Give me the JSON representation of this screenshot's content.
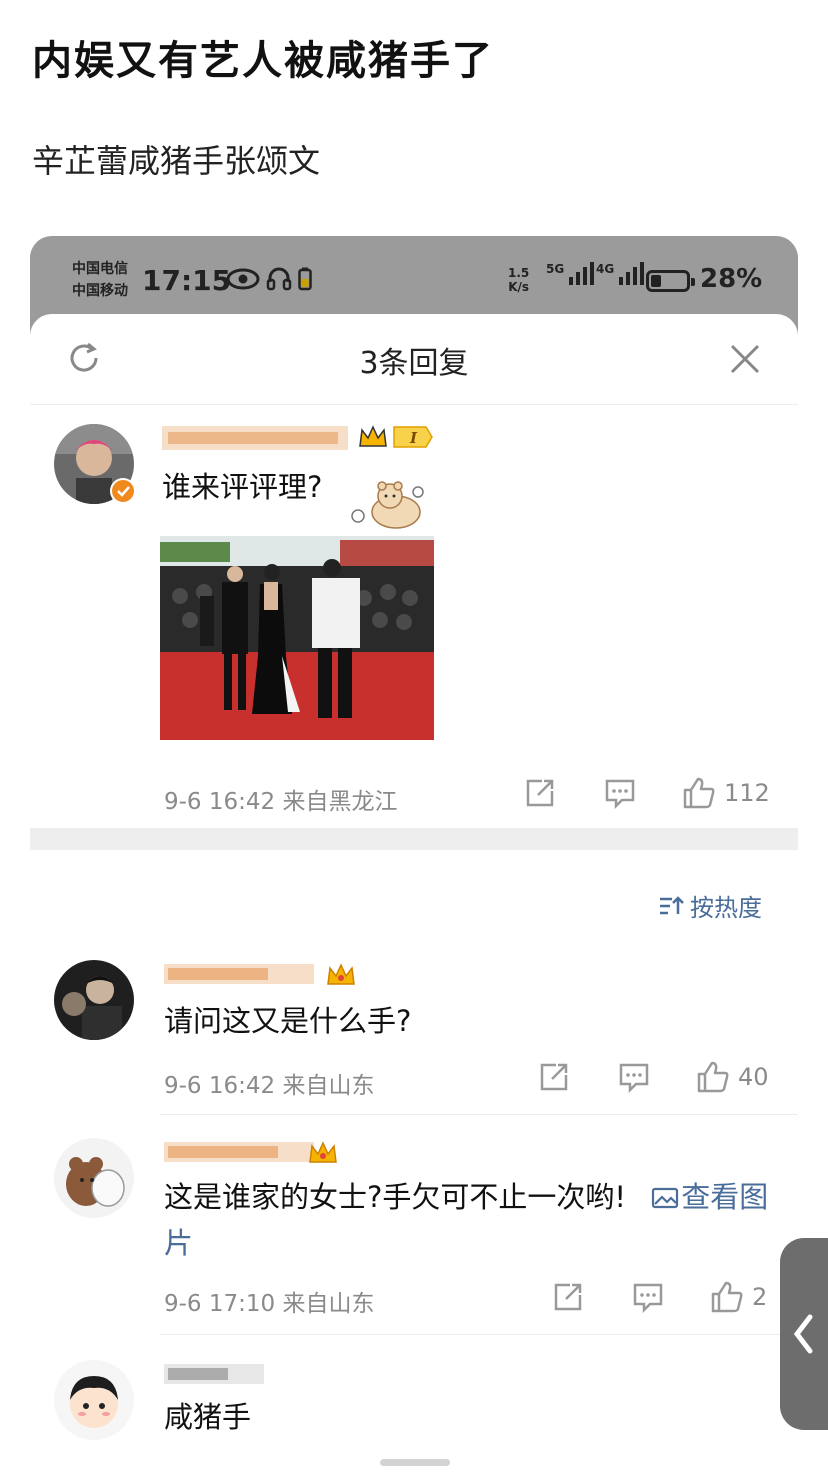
{
  "post": {
    "title": "内娱又有艺人被咸猪手了",
    "subtitle": "辛芷蕾咸猪手张颂文"
  },
  "statusbar": {
    "carrier1": "中国电信",
    "carrier2": "中国移动",
    "time": "17:15",
    "net_speed_top": "1.5",
    "net_speed_bottom": "K/s",
    "sig1_label": "5G",
    "sig2_label": "4G",
    "battery_level": 0.28,
    "battery_pct": "28%"
  },
  "sheet": {
    "title": "3条回复"
  },
  "main_comment": {
    "text": "谁来评评理?",
    "time_location": "9-6 16:42 来自黑龙江",
    "likes": "112"
  },
  "sort_label": "按热度",
  "replies": [
    {
      "text": "请问这又是什么手?",
      "time_location": "9-6 16:42 来自山东",
      "likes": "40"
    },
    {
      "text": "这是谁家的女士?手欠可不止一次哟!",
      "view_image": "查看图片",
      "time_location": "9-6 17:10 来自山东",
      "likes": "2"
    },
    {
      "text": "咸猪手"
    }
  ],
  "colors": {
    "statusbar_bg": "#9b9b9b",
    "username": "#e3862e",
    "link": "#4a6d9a",
    "meta": "#8a8a8a",
    "carpet_red": "#c8302e"
  },
  "icons": [
    "refresh-icon",
    "close-icon",
    "share-icon",
    "comment-icon",
    "thumbs-up-icon",
    "sort-icon",
    "image-icon",
    "verified-icon",
    "crown-icon",
    "eye-icon",
    "headphones-icon"
  ]
}
